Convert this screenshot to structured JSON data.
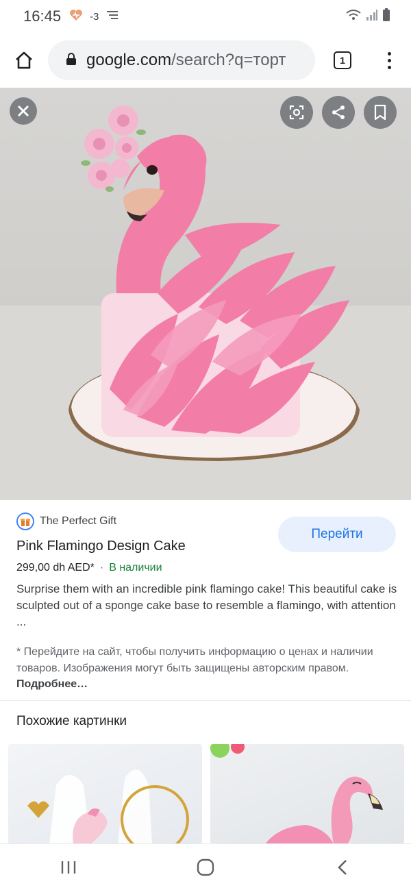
{
  "status_bar": {
    "time": "16:45",
    "temperature": "-3",
    "left_icons": [
      "health-heart-icon",
      "notification-icon"
    ],
    "right_icons": [
      "wifi-icon",
      "signal-icon",
      "battery-icon"
    ]
  },
  "browser": {
    "url_domain": "google.com",
    "url_path": "/search?q=торт",
    "tab_count": "1",
    "home_icon": "home-icon",
    "lock_icon": "lock-icon",
    "menu_icon": "more-vertical-icon"
  },
  "image_viewer": {
    "subject": "Pink flamingo cake",
    "buttons": [
      "close-icon",
      "lens-icon",
      "share-icon",
      "bookmark-icon"
    ]
  },
  "result": {
    "source_name": "The Perfect Gift",
    "goto_label": "Перейти",
    "title": "Pink Flamingo Design Cake",
    "price": "299,00 dh AED*",
    "separator": "·",
    "availability": "В наличии",
    "description": "Surprise them with an incredible pink flamingo cake! This beautiful cake is sculpted out of a sponge cake base to resemble a flamingo, with attention ...",
    "disclaimer": "* Перейдите на сайт, чтобы получить информацию о ценах и наличии товаров. Изображения могут быть защищены авторским правом.",
    "more_label": "Подробнее…"
  },
  "related": {
    "title": "Похожие картинки"
  },
  "nav_bar": {
    "icons": [
      "recent-apps-icon",
      "home-circle-icon",
      "back-icon"
    ]
  },
  "colors": {
    "accent": "#1a73e8",
    "accent_bg": "#e8f0fe",
    "in_stock": "#188038",
    "flamingo_pink": "#f27ea8"
  }
}
